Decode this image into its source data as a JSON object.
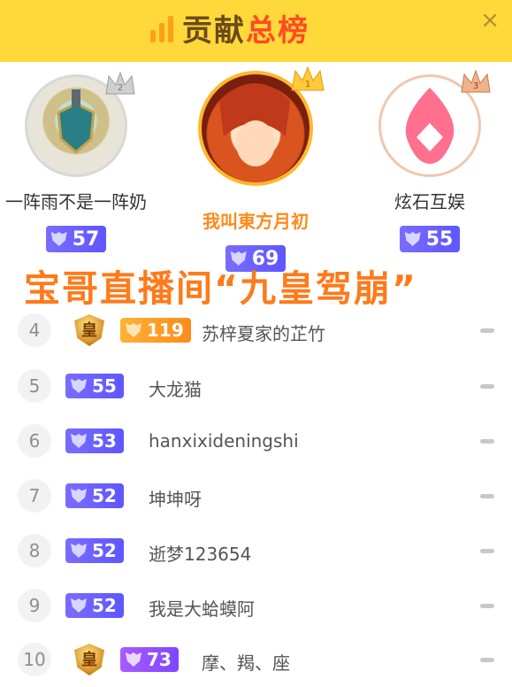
{
  "header": {
    "title_part1": "贡献",
    "title_part2": "总榜",
    "close_glyph": "×"
  },
  "podium": [
    {
      "rank": "2",
      "name": "一阵雨不是一阵奶",
      "level": "57"
    },
    {
      "rank": "1",
      "name": "我叫東方月初",
      "level": "69"
    },
    {
      "rank": "3",
      "name": "炫石互娱",
      "level": "55"
    }
  ],
  "overlay_caption": "宝哥直播间“九皇驾崩”",
  "list": [
    {
      "rank": "4",
      "name": "苏梓夏家的芷竹",
      "level": "119",
      "emblem": "皇",
      "badge_color": "orange"
    },
    {
      "rank": "5",
      "name": "大龙猫",
      "level": "55",
      "badge_color": "blue"
    },
    {
      "rank": "6",
      "name": "hanxixideningshi",
      "level": "53",
      "badge_color": "blue"
    },
    {
      "rank": "7",
      "name": "坤坤呀",
      "level": "52",
      "badge_color": "blue"
    },
    {
      "rank": "8",
      "name": "逝梦123654",
      "level": "52",
      "badge_color": "blue"
    },
    {
      "rank": "9",
      "name": "我是大蛤蟆阿",
      "level": "52",
      "badge_color": "blue"
    },
    {
      "rank": "10",
      "name": "摩、羯、座",
      "level": "73",
      "emblem": "皇",
      "badge_color": "purple"
    }
  ],
  "colors": {
    "header_bg": "#ffd83a",
    "accent_orange": "#ff7a1a",
    "badge_blue": "#6a5fff"
  }
}
